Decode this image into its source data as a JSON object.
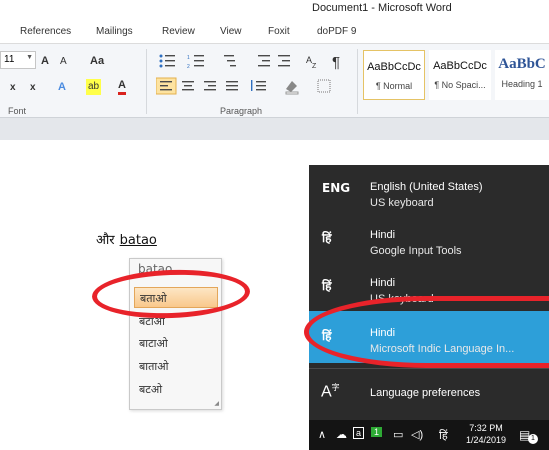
{
  "window": {
    "title": "Document1 - Microsoft Word"
  },
  "tabs": [
    "References",
    "Mailings",
    "Review",
    "View",
    "Foxit",
    "doPDF 9"
  ],
  "ribbon": {
    "font_size": "11",
    "groups": {
      "font": "Font",
      "paragraph": "Paragraph"
    },
    "buttons": {
      "grow_font": "A",
      "shrink_font": "A",
      "change_case": "Aa",
      "subscript": "x",
      "superscript": "x",
      "text_effects": "A",
      "highlight": "ab",
      "font_color": "A",
      "show_marks": "¶"
    },
    "styles": [
      {
        "sample": "AaBbCcDc",
        "name": "¶ Normal"
      },
      {
        "sample": "AaBbCcDc",
        "name": "¶ No Spaci..."
      },
      {
        "sample": "AaBbC",
        "name": "Heading 1"
      }
    ]
  },
  "document": {
    "word_hindi": "और",
    "typed": "batao"
  },
  "ime_popup": {
    "query": "batao",
    "options": [
      "बताओ",
      "बटाओ",
      "बाटाओ",
      "बाताओ",
      "बटओ"
    ],
    "selected_index": 0
  },
  "language_flyout": {
    "items": [
      {
        "abbr": "ENG",
        "language": "English (United States)",
        "keyboard": "US keyboard"
      },
      {
        "abbr": "हिं",
        "language": "Hindi",
        "keyboard": "Google Input Tools"
      },
      {
        "abbr": "हिं",
        "language": "Hindi",
        "keyboard": "US keyboard"
      },
      {
        "abbr": "हिं",
        "language": "Hindi",
        "keyboard": "Microsoft Indic Language In..."
      }
    ],
    "active_index": 3,
    "preferences_label": "Language preferences"
  },
  "taskbar": {
    "input_indicator": "हिं",
    "time": "7:32 PM",
    "date": "1/24/2019",
    "notification_count": "1"
  },
  "colors": {
    "active": "#2d9fd9",
    "flyout_bg": "#2b2b2b",
    "annotation": "#e8232a"
  }
}
